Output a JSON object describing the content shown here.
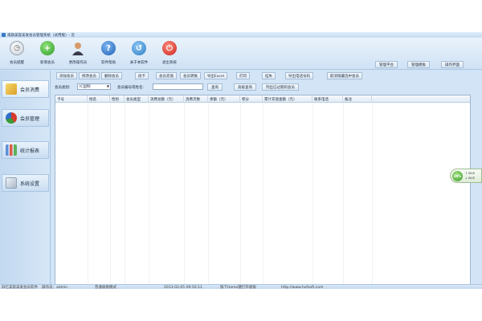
{
  "window": {
    "title": "海旗美容美发会员管理系统（试用版）- 云"
  },
  "toolbar": {
    "buttons": [
      {
        "label": "会员提醒",
        "icon": "clock-icon"
      },
      {
        "label": "新增会员",
        "icon": "add-icon"
      },
      {
        "label": "更改操作员",
        "icon": "user-icon"
      },
      {
        "label": "软件帮助",
        "icon": "help-icon"
      },
      {
        "label": "关于本软件",
        "icon": "refresh-icon"
      },
      {
        "label": "退出系统",
        "icon": "power-icon"
      }
    ],
    "right_buttons": [
      "管理平台",
      "管理模板",
      "操作界面"
    ]
  },
  "sidebar": {
    "items": [
      {
        "label": "会员消费",
        "icon": "member-icon",
        "active": true
      },
      {
        "label": "会员管理",
        "icon": "pie-chart-icon",
        "active": false
      },
      {
        "label": "统计报表",
        "icon": "bar-chart-icon",
        "active": false
      },
      {
        "label": "系统设置",
        "icon": "settings-icon",
        "active": false
      }
    ]
  },
  "actions": [
    "添加会员",
    "修改会员",
    "删除会员",
    "续卡",
    "会员充值",
    "会员转账",
    "导出Excel",
    "打印",
    "挂失",
    "导出电话号码",
    "取消隐藏选中会员"
  ],
  "search": {
    "category_label": "会员类别:",
    "category_value": "IC固制",
    "keyword_label": "会员编号或姓名:",
    "keyword_value": "",
    "query_button": "查询",
    "advanced_button": "高级查询",
    "expired_button": "列出已过期的会员"
  },
  "grid": {
    "columns": [
      "卡号",
      "姓名",
      "性别",
      "会员类型",
      "消费总额（元）",
      "消费次数",
      "余额（元）",
      "积分",
      "累计充值金额（元）",
      "联系电话",
      "备注"
    ]
  },
  "widget": {
    "percent": "39%",
    "line1": "↑ 0K/S",
    "line2": "↓ 0K/S"
  },
  "status": {
    "company": "旧忆美容美发会员软件",
    "operator": "操作员：admin",
    "mode": "普通收银模式",
    "datetime": "2013-02-05 09:50:11",
    "tip": "按下Home键打开收银",
    "url": "http://www.hxfsoft.com"
  },
  "colors": {
    "window_bg": "#d2e4f5",
    "toolbar_bg": "#eaf3fc",
    "grid_bg": "#ffffff",
    "border": "#a9c6e4"
  }
}
